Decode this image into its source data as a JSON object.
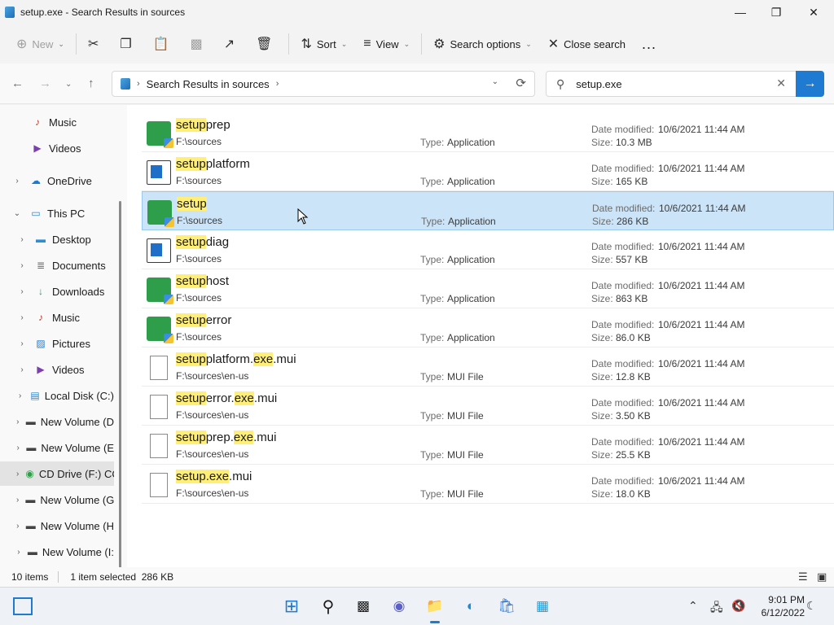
{
  "window": {
    "title": "setup.exe - Search Results in sources"
  },
  "toolbar": {
    "new_label": "New",
    "sort_label": "Sort",
    "view_label": "View",
    "search_options_label": "Search options",
    "close_search_label": "Close search",
    "more_label": "..."
  },
  "address": {
    "crumb": "Search Results in sources"
  },
  "search": {
    "value": "setup.exe"
  },
  "nav": {
    "items": [
      {
        "label": "Music",
        "icon": "music-icon"
      },
      {
        "label": "Videos",
        "icon": "videos-icon"
      },
      {
        "label": "OneDrive",
        "icon": "onedrive-icon"
      },
      {
        "label": "This PC",
        "icon": "this-pc-icon"
      },
      {
        "label": "Desktop",
        "icon": "desktop-icon"
      },
      {
        "label": "Documents",
        "icon": "documents-icon"
      },
      {
        "label": "Downloads",
        "icon": "downloads-icon"
      },
      {
        "label": "Music",
        "icon": "music-icon"
      },
      {
        "label": "Pictures",
        "icon": "pictures-icon"
      },
      {
        "label": "Videos",
        "icon": "videos-icon"
      },
      {
        "label": "Local Disk (C:)",
        "icon": "local-disk-icon"
      },
      {
        "label": "New Volume (D",
        "icon": "drive-icon"
      },
      {
        "label": "New Volume (E",
        "icon": "drive-icon"
      },
      {
        "label": "CD Drive (F:) CC",
        "icon": "cd-drive-icon"
      },
      {
        "label": "New Volume (G",
        "icon": "drive-icon"
      },
      {
        "label": "New Volume (H",
        "icon": "drive-icon"
      },
      {
        "label": "New Volume (I:",
        "icon": "drive-icon"
      }
    ]
  },
  "columns": {
    "type_label": "Type:",
    "date_label": "Date modified:",
    "size_label": "Size:"
  },
  "files": [
    {
      "pre": "setup",
      "post1": "prep",
      "mid": "",
      "post2": "",
      "path": "F:\\sources",
      "type": "Application",
      "date": "10/6/2021 11:44 AM",
      "size": "10.3 MB",
      "icon": "app-installer-icon"
    },
    {
      "pre": "setup",
      "post1": "platform",
      "mid": "",
      "post2": "",
      "path": "F:\\sources",
      "type": "Application",
      "date": "10/6/2021 11:44 AM",
      "size": "165 KB",
      "icon": "app-window-icon"
    },
    {
      "pre": "setup",
      "post1": "",
      "mid": "",
      "post2": "",
      "path": "F:\\sources",
      "type": "Application",
      "date": "10/6/2021 11:44 AM",
      "size": "286 KB",
      "icon": "app-installer-icon"
    },
    {
      "pre": "setup",
      "post1": "diag",
      "mid": "",
      "post2": "",
      "path": "F:\\sources",
      "type": "Application",
      "date": "10/6/2021 11:44 AM",
      "size": "557 KB",
      "icon": "app-window-icon"
    },
    {
      "pre": "setup",
      "post1": "host",
      "mid": "",
      "post2": "",
      "path": "F:\\sources",
      "type": "Application",
      "date": "10/6/2021 11:44 AM",
      "size": "863 KB",
      "icon": "app-installer-icon"
    },
    {
      "pre": "setup",
      "post1": "error",
      "mid": "",
      "post2": "",
      "path": "F:\\sources",
      "type": "Application",
      "date": "10/6/2021 11:44 AM",
      "size": "86.0 KB",
      "icon": "app-installer-icon"
    },
    {
      "pre": "setup",
      "post1": "platform.",
      "mid": "exe",
      "post2": ".mui",
      "path": "F:\\sources\\en-us",
      "type": "MUI File",
      "date": "10/6/2021 11:44 AM",
      "size": "12.8 KB",
      "icon": "file-icon"
    },
    {
      "pre": "setup",
      "post1": "error.",
      "mid": "exe",
      "post2": ".mui",
      "path": "F:\\sources\\en-us",
      "type": "MUI File",
      "date": "10/6/2021 11:44 AM",
      "size": "3.50 KB",
      "icon": "file-icon"
    },
    {
      "pre": "setup",
      "post1": "prep.",
      "mid": "exe",
      "post2": ".mui",
      "path": "F:\\sources\\en-us",
      "type": "MUI File",
      "date": "10/6/2021 11:44 AM",
      "size": "25.5 KB",
      "icon": "file-icon"
    },
    {
      "pre": "setup.exe",
      "post1": ".mui",
      "mid": "",
      "post2": "",
      "path": "F:\\sources\\en-us",
      "type": "MUI File",
      "date": "10/6/2021 11:44 AM",
      "size": "18.0 KB",
      "icon": "file-icon"
    }
  ],
  "status": {
    "count": "10 items",
    "selection": "1 item selected  286 KB"
  },
  "clock": {
    "time": "9:01 PM",
    "date": "6/12/2022"
  },
  "colors": {
    "accent": "#1f7bd1",
    "highlight": "#ffef76",
    "selected_row": "#cce4f7"
  }
}
